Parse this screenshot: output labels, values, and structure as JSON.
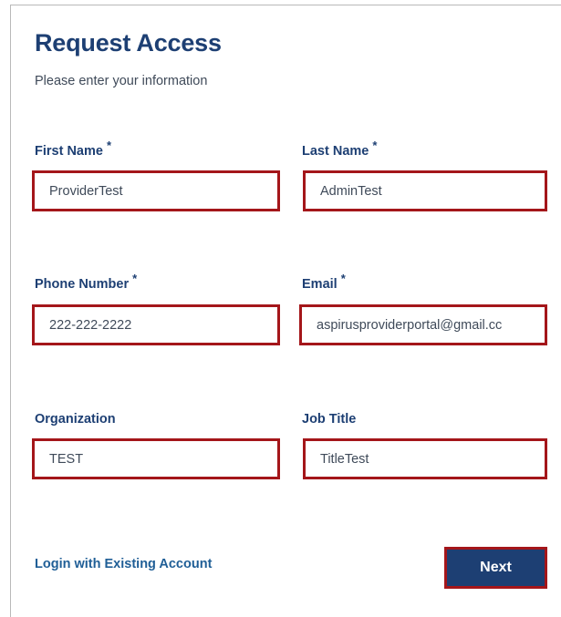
{
  "header": {
    "title": "Request Access",
    "subtitle": "Please enter your information"
  },
  "form": {
    "first_name": {
      "label": "First Name",
      "required_mark": "*",
      "value": "ProviderTest"
    },
    "last_name": {
      "label": "Last Name",
      "required_mark": "*",
      "value": "AdminTest"
    },
    "phone": {
      "label": "Phone Number",
      "required_mark": "*",
      "value": "222-222-2222"
    },
    "email": {
      "label": "Email",
      "required_mark": "*",
      "value": "aspirusproviderportal@gmail.cc"
    },
    "organization": {
      "label": "Organization",
      "value": "TEST"
    },
    "job_title": {
      "label": "Job Title",
      "value": "TitleTest"
    }
  },
  "footer": {
    "login_link": "Login with Existing Account",
    "next_label": "Next"
  },
  "colors": {
    "brand_navy": "#1d3f73",
    "highlight_red": "#a4161a",
    "link_blue": "#1f5e96"
  }
}
